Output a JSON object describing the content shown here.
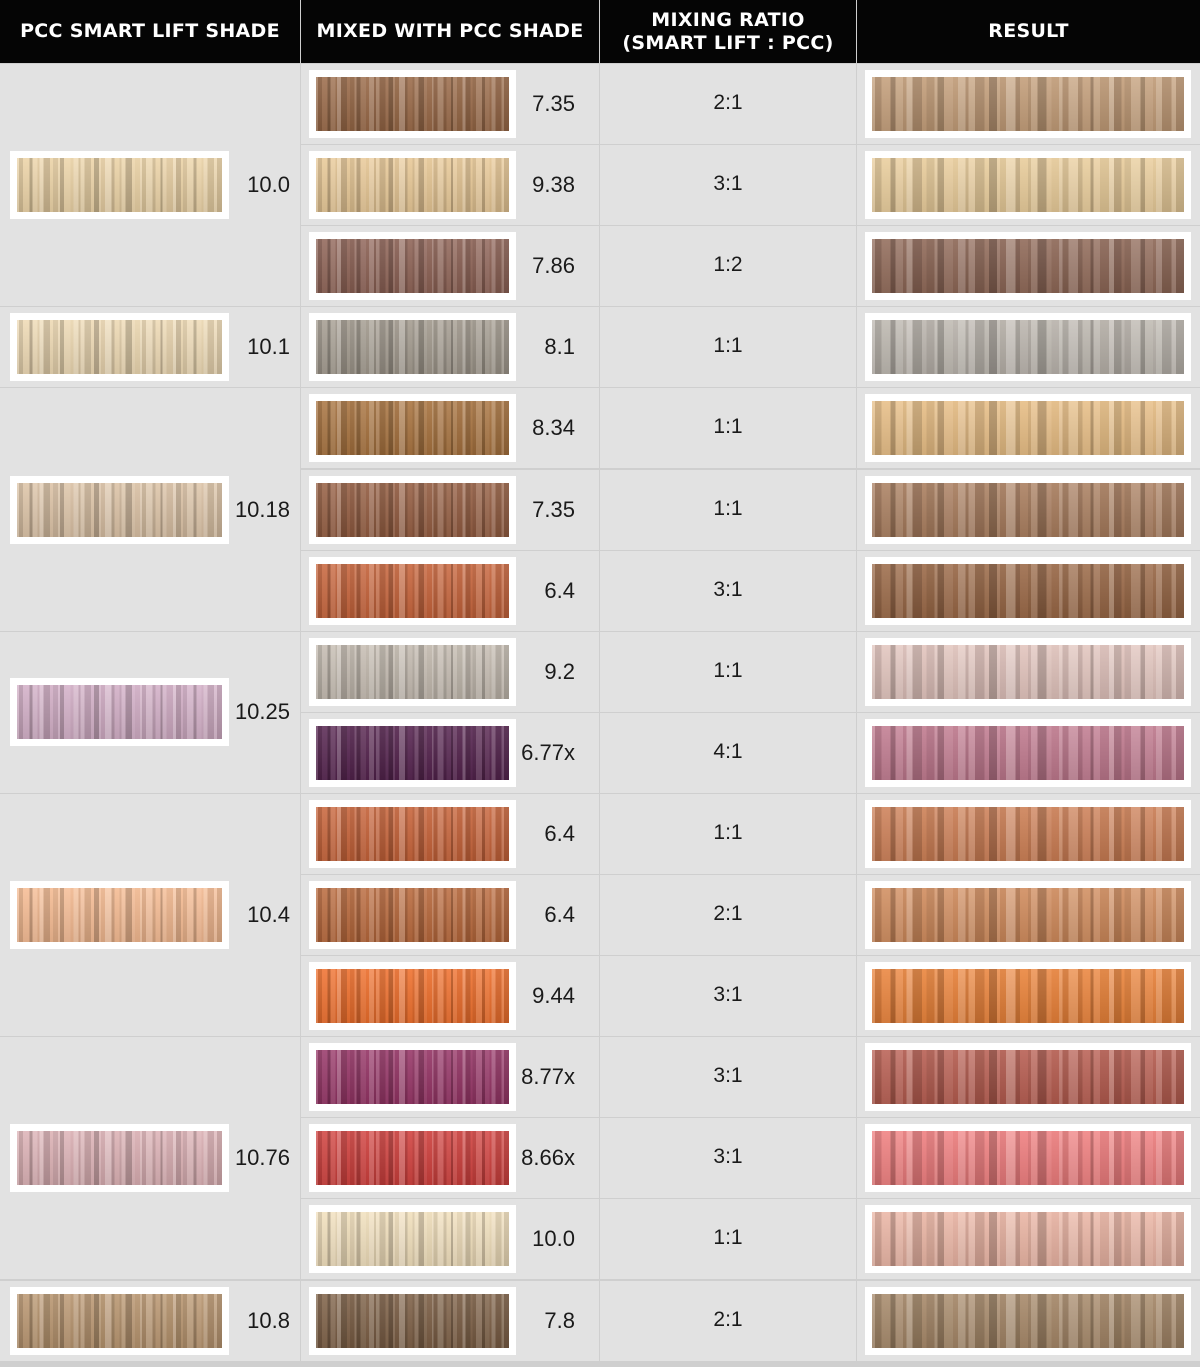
{
  "headers": {
    "smart_lift": "PCC SMART LIFT SHADE",
    "mixed_with": "MIXED WITH PCC SHADE",
    "ratio_line1": "MIXING RATIO",
    "ratio_line2": "(SMART LIFT : PCC)",
    "result": "RESULT"
  },
  "groups": [
    {
      "smart_lift_shade": "10.0",
      "smart_lift_color": "#ecd3a6",
      "rows": [
        {
          "pcc_shade": "7.35",
          "pcc_color": "#9a6a48",
          "ratio": "2:1",
          "result_color": "#c39d78"
        },
        {
          "pcc_shade": "9.38",
          "pcc_color": "#e8c896",
          "ratio": "3:1",
          "result_color": "#e9cc9a"
        },
        {
          "pcc_shade": "7.86",
          "pcc_color": "#8e6356",
          "ratio": "1:2",
          "result_color": "#8f6857"
        }
      ]
    },
    {
      "smart_lift_shade": "10.1",
      "smart_lift_color": "#eed9b3",
      "rows": [
        {
          "pcc_shade": "8.1",
          "pcc_color": "#a39b8f",
          "ratio": "1:1",
          "result_color": "#bcb6ae"
        }
      ]
    },
    {
      "smart_lift_shade": "10.18",
      "smart_lift_color": "#dcc3a6",
      "rows": [
        {
          "pcc_shade": "8.34",
          "pcc_color": "#a8733f",
          "ratio": "1:1",
          "result_color": "#e7bd84"
        },
        {
          "pcc_shade": "7.35",
          "pcc_color": "#955e42",
          "ratio": "1:1",
          "result_color": "#a97d5e"
        },
        {
          "pcc_shade": "6.4",
          "pcc_color": "#c7643b",
          "ratio": "3:1",
          "result_color": "#9a6846"
        }
      ]
    },
    {
      "smart_lift_shade": "10.25",
      "smart_lift_color": "#d2aec6",
      "rows": [
        {
          "pcc_shade": "9.2",
          "pcc_color": "#c4bbb0",
          "ratio": "1:1",
          "result_color": "#e2c4bd"
        },
        {
          "pcc_shade": "6.77x",
          "pcc_color": "#56244f",
          "ratio": "4:1",
          "result_color": "#c0798e"
        }
      ]
    },
    {
      "smart_lift_shade": "10.4",
      "smart_lift_color": "#f5bb92",
      "rows": [
        {
          "pcc_shade": "6.4",
          "pcc_color": "#c76339",
          "ratio": "1:1",
          "result_color": "#cc7e54"
        },
        {
          "pcc_shade": "6.4",
          "pcc_color": "#b9693c",
          "ratio": "2:1",
          "result_color": "#d08b5c"
        },
        {
          "pcc_shade": "9.44",
          "pcc_color": "#ef6f2c",
          "ratio": "3:1",
          "result_color": "#ea8239"
        }
      ]
    },
    {
      "smart_lift_shade": "10.76",
      "smart_lift_color": "#dcb1b5",
      "rows": [
        {
          "pcc_shade": "8.77x",
          "pcc_color": "#963566",
          "ratio": "3:1",
          "result_color": "#b75d50"
        },
        {
          "pcc_shade": "8.66x",
          "pcc_color": "#d0403d",
          "ratio": "3:1",
          "result_color": "#ef7d7e"
        },
        {
          "pcc_shade": "10.0",
          "pcc_color": "#f1dfbc",
          "ratio": "1:1",
          "result_color": "#eab4a3"
        }
      ]
    },
    {
      "smart_lift_shade": "10.8",
      "smart_lift_color": "#b99670",
      "rows": [
        {
          "pcc_shade": "7.8",
          "pcc_color": "#7d6046",
          "ratio": "2:1",
          "result_color": "#a68868"
        }
      ]
    }
  ]
}
